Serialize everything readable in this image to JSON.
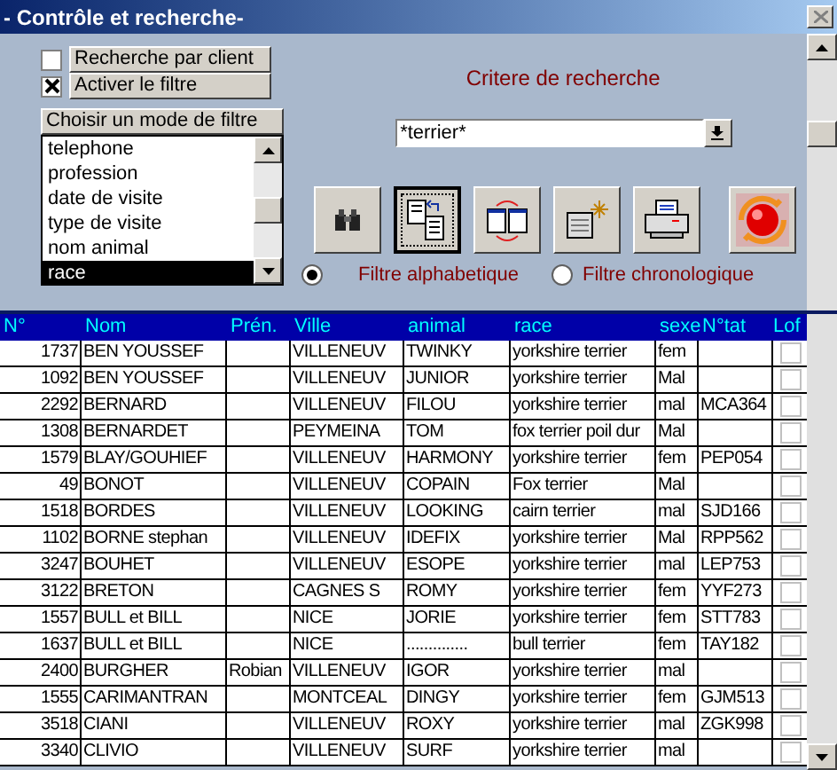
{
  "window": {
    "title": "- Contrôle et  recherche-"
  },
  "filters": [
    {
      "label": "Recherche par client",
      "checked": false
    },
    {
      "label": "Activer le filtre",
      "checked": true
    }
  ],
  "filter_mode": {
    "header": "Choisir un mode de filtre",
    "items": [
      {
        "label": "telephone",
        "selected": false
      },
      {
        "label": "profession",
        "selected": false
      },
      {
        "label": "date de visite",
        "selected": false
      },
      {
        "label": "type de visite",
        "selected": false
      },
      {
        "label": "nom animal",
        "selected": false
      },
      {
        "label": "race",
        "selected": true
      }
    ]
  },
  "criteria": {
    "label": "Critere de recherche",
    "value": "*terrier*"
  },
  "toolbar": [
    {
      "kind": "search",
      "pressed": false
    },
    {
      "kind": "copy",
      "pressed": true
    },
    {
      "kind": "swap",
      "pressed": false
    },
    {
      "kind": "new",
      "pressed": false
    },
    {
      "kind": "print",
      "pressed": false
    },
    {
      "kind": "refresh",
      "pressed": false
    }
  ],
  "sort": [
    {
      "label": "Filtre alphabetique",
      "selected": true
    },
    {
      "label": "Filtre chronologique",
      "selected": false
    }
  ],
  "table": {
    "columns": [
      "N°",
      "Nom",
      "Prén.",
      "Ville",
      "animal",
      "race",
      "sexe",
      "N°tat",
      "Lof"
    ],
    "rows": [
      {
        "cells": [
          "1737",
          "BEN YOUSSEF",
          "",
          "VILLENEUV",
          "TWINKY",
          "yorkshire terrier",
          "fem",
          ""
        ],
        "lof": false
      },
      {
        "cells": [
          "1092",
          "BEN YOUSSEF",
          "",
          "VILLENEUV",
          "JUNIOR",
          "yorkshire terrier",
          "Mal",
          ""
        ],
        "lof": false
      },
      {
        "cells": [
          "2292",
          "BERNARD",
          "",
          "VILLENEUV",
          "FILOU",
          "yorkshire terrier",
          "mal",
          "MCA364"
        ],
        "lof": false
      },
      {
        "cells": [
          "1308",
          "BERNARDET",
          "",
          "PEYMEINA",
          "TOM",
          "fox terrier poil dur",
          "Mal",
          ""
        ],
        "lof": false
      },
      {
        "cells": [
          "1579",
          "BLAY/GOUHIEF",
          "",
          "VILLENEUV",
          "HARMONY",
          "yorkshire terrier",
          "fem",
          "PEP054"
        ],
        "lof": false
      },
      {
        "cells": [
          "49",
          "BONOT",
          "",
          "VILLENEUV",
          "COPAIN",
          "Fox terrier",
          "Mal",
          ""
        ],
        "lof": false
      },
      {
        "cells": [
          "1518",
          "BORDES",
          "",
          "VILLENEUV",
          "LOOKING",
          "cairn terrier",
          "mal",
          "SJD166"
        ],
        "lof": false
      },
      {
        "cells": [
          "1102",
          "BORNE stephan",
          "",
          "VILLENEUV",
          "IDEFIX",
          "yorkshire terrier",
          "Mal",
          "RPP562"
        ],
        "lof": false
      },
      {
        "cells": [
          "3247",
          "BOUHET",
          "",
          "VILLENEUV",
          "ESOPE",
          "yorkshire terrier",
          "mal",
          "LEP753"
        ],
        "lof": false
      },
      {
        "cells": [
          "3122",
          "BRETON",
          "",
          "CAGNES S",
          "ROMY",
          "yorkshire terrier",
          "fem",
          "YYF273"
        ],
        "lof": false
      },
      {
        "cells": [
          "1557",
          "BULL et BILL",
          "",
          "NICE",
          "JORIE",
          "yorkshire terrier",
          "fem",
          "STT783"
        ],
        "lof": false
      },
      {
        "cells": [
          "1637",
          "BULL et BILL",
          "",
          "NICE",
          "..............",
          "bull terrier",
          "fem",
          "TAY182"
        ],
        "lof": false
      },
      {
        "cells": [
          "2400",
          "BURGHER",
          "Robian",
          "VILLENEUV",
          "IGOR",
          "yorkshire terrier",
          "mal",
          ""
        ],
        "lof": false
      },
      {
        "cells": [
          "1555",
          "CARIMANTRAN",
          "",
          "MONTCEAL",
          "DINGY",
          "yorkshire terrier",
          "fem",
          "GJM513"
        ],
        "lof": false
      },
      {
        "cells": [
          "3518",
          "CIANI",
          "",
          "VILLENEUV",
          "ROXY",
          "yorkshire terrier",
          "mal",
          "ZGK998"
        ],
        "lof": false
      },
      {
        "cells": [
          "3340",
          "CLIVIO",
          "",
          "VILLENEUV",
          "SURF",
          "yorkshire terrier",
          "mal",
          ""
        ],
        "lof": false
      }
    ]
  }
}
